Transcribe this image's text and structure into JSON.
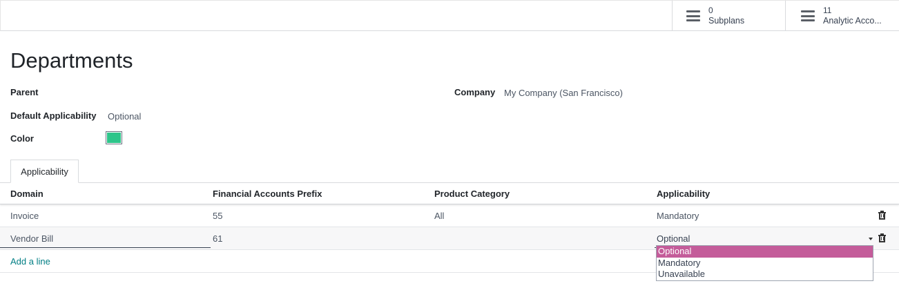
{
  "smart_buttons": [
    {
      "count": "0",
      "label": "Subplans",
      "icon": "list-icon"
    },
    {
      "count": "11",
      "label": "Analytic Acco...",
      "icon": "list-icon"
    }
  ],
  "record": {
    "title": "Departments",
    "parent_label": "Parent",
    "parent_value": "",
    "default_applicability_label": "Default Applicability",
    "default_applicability_value": "Optional",
    "color_label": "Color",
    "color_value": "#2ec58a",
    "company_label": "Company",
    "company_value": "My Company (San Francisco)"
  },
  "tabs": [
    {
      "label": "Applicability"
    }
  ],
  "table": {
    "columns": [
      "Domain",
      "Financial Accounts Prefix",
      "Product Category",
      "Applicability"
    ],
    "rows": [
      {
        "domain": "Invoice",
        "prefix": "55",
        "category": "All",
        "applicability": "Mandatory"
      },
      {
        "domain": "Vendor Bill",
        "prefix": "61",
        "category": "",
        "applicability": "Optional"
      }
    ],
    "add_line_label": "Add a line"
  },
  "applicability_dropdown": {
    "options": [
      "Optional",
      "Mandatory",
      "Unavailable"
    ],
    "highlighted": "Optional",
    "highlight_color": "#c45c9a"
  }
}
